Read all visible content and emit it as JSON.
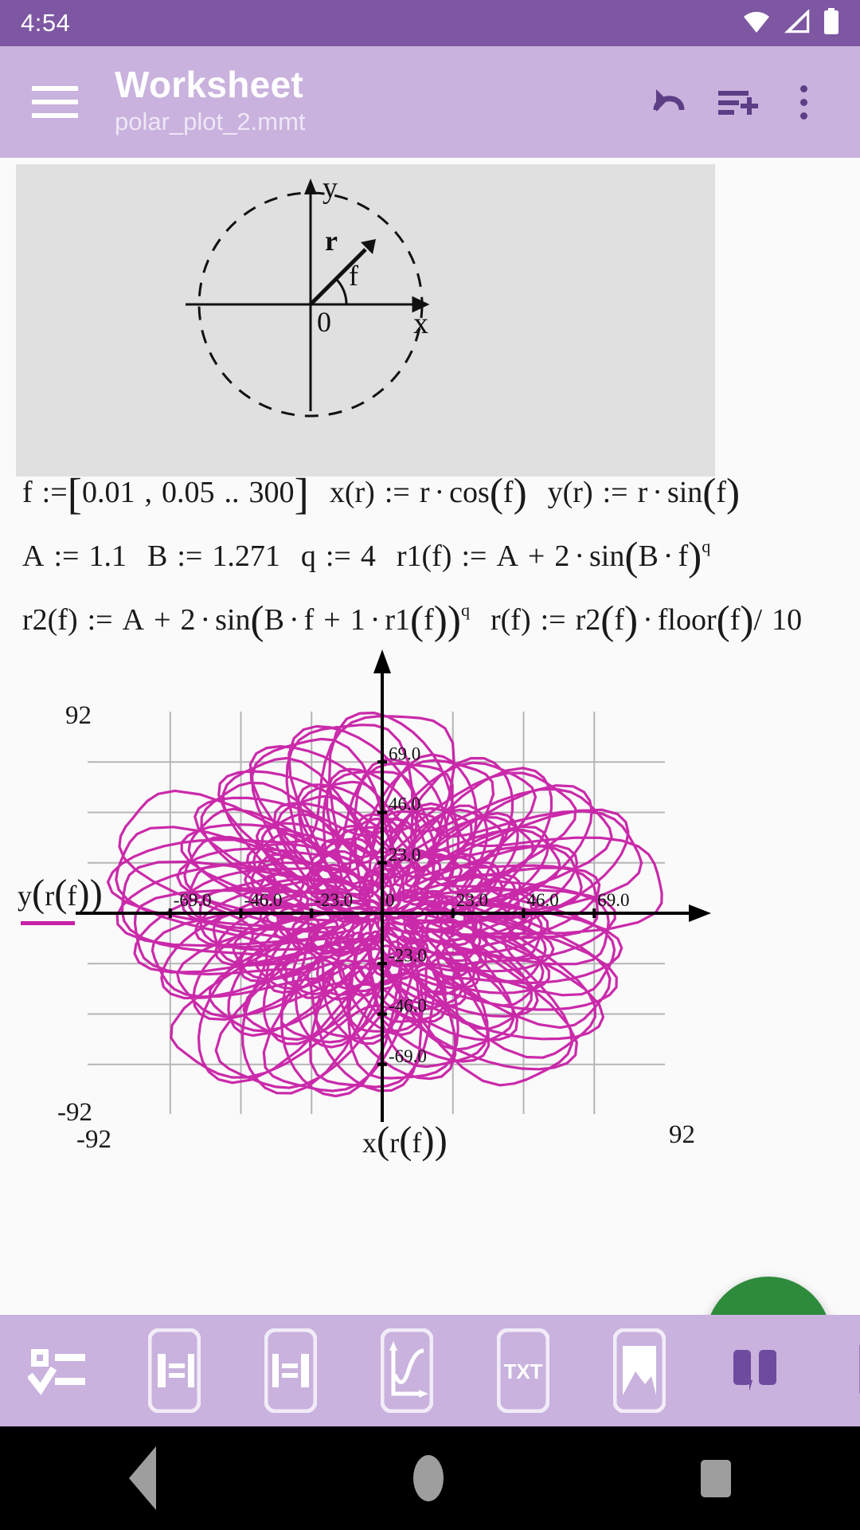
{
  "status_bar": {
    "time": "4:54",
    "icons": [
      "wifi-icon",
      "signal-icon",
      "battery-icon"
    ]
  },
  "app_bar": {
    "menu_icon": "hamburger-menu-icon",
    "title": "Worksheet",
    "subtitle": "polar_plot_2.mmt",
    "actions": [
      {
        "name": "undo-icon",
        "label": "Undo"
      },
      {
        "name": "add-line-icon",
        "label": "Insert line"
      },
      {
        "name": "overflow-menu-icon",
        "label": "More options"
      }
    ]
  },
  "document": {
    "header_image": {
      "name": "polar-coordinates-diagram",
      "labels": {
        "y_axis": "y",
        "x_axis": "x",
        "radius": "r",
        "angle": "f",
        "origin": "0"
      }
    },
    "formulas": [
      {
        "id": "line-1",
        "parts": [
          {
            "text": "f"
          },
          {
            "text": ":="
          },
          {
            "text": "["
          },
          {
            "text": "0.01"
          },
          {
            "text": ","
          },
          {
            "text": "0.05"
          },
          {
            "text": ".."
          },
          {
            "text": "300"
          },
          {
            "text": "]"
          },
          {
            "text": "x(r)"
          },
          {
            "text": ":="
          },
          {
            "text": "r"
          },
          {
            "text": "·"
          },
          {
            "text": "cos"
          },
          {
            "text": "("
          },
          {
            "text": "f"
          },
          {
            "text": ")"
          },
          {
            "text": "y(r)"
          },
          {
            "text": ":="
          },
          {
            "text": "r"
          },
          {
            "text": "·"
          },
          {
            "text": "sin"
          },
          {
            "text": "("
          },
          {
            "text": "f"
          },
          {
            "text": ")"
          }
        ],
        "plain": "f := [0.01 , 0.05 .. 300]   x(r) := r · cos(f)   y(r) := r · sin(f)"
      },
      {
        "id": "line-2",
        "plain": "A := 1.1   B := 1.271   q := 4   r1(f) := A + 2 · sin(B · f)^q"
      },
      {
        "id": "line-3",
        "plain": "r2(f) := A + 2 · sin(B · f + 1 · r1(f))^q   r(f) := r2(f) · floor(f)/10"
      }
    ],
    "assignments": {
      "A": "1.1",
      "B": "1.271",
      "q": "4",
      "f_range_start": "0.01",
      "f_range_step": "0.05",
      "f_range_end": "300",
      "divisor": "10"
    }
  },
  "chart_data": {
    "type": "line",
    "title": "",
    "xlabel": "x(r(f))",
    "ylabel": "y(r(f))",
    "xlim": [
      -92,
      92
    ],
    "ylim": [
      -92,
      92
    ],
    "x_corner_min": "-92",
    "x_corner_max": "92",
    "y_corner_min": "-92",
    "y_corner_max": "92",
    "xticks": [
      "-69.0",
      "-46.0",
      "-23.0",
      "0",
      "23.0",
      "46.0",
      "69.0"
    ],
    "xtick_values": [
      -69,
      -46,
      -23,
      0,
      23,
      46,
      69
    ],
    "yticks": [
      "69.0",
      "46.0",
      "23.0",
      "0",
      "-23.0",
      "-46.0",
      "-69.0"
    ],
    "ytick_values": [
      69,
      46,
      23,
      0,
      -23,
      -46,
      -69
    ],
    "grid": true,
    "legend_position": "left",
    "series": [
      {
        "name": "y(r(f))",
        "color": "#c71fa5",
        "parametric": true,
        "param": "f",
        "param_start": 0.01,
        "param_step": 0.05,
        "param_end": 300,
        "r_expression": "r2(f)*floor(f)/10",
        "x_expression": "r(f)*cos(f)",
        "y_expression": "r(f)*sin(f)"
      }
    ]
  },
  "run_button": {
    "name": "run-calculation-button",
    "icon": "play-icon"
  },
  "toolbar": {
    "items": [
      {
        "name": "toolbar-checklist",
        "icon": "checklist-icon",
        "label": ""
      },
      {
        "name": "toolbar-assign-right",
        "icon": "assign-right-icon",
        "label": ""
      },
      {
        "name": "toolbar-assign-left",
        "icon": "assign-left-icon",
        "label": ""
      },
      {
        "name": "toolbar-plot",
        "icon": "plot-icon",
        "label": ""
      },
      {
        "name": "toolbar-text",
        "icon": "txt-icon",
        "label": "TXT"
      },
      {
        "name": "toolbar-image",
        "icon": "image-icon",
        "label": ""
      },
      {
        "name": "toolbar-matrix",
        "icon": "matrix-icon",
        "label": ""
      },
      {
        "name": "toolbar-bracket",
        "icon": "bracket-icon",
        "label": ""
      }
    ]
  },
  "nav_bar": {
    "back": "back-nav-button",
    "home": "home-nav-button",
    "recents": "recents-nav-button"
  },
  "colors": {
    "status_bar": "#7e57a2",
    "app_bar": "#c9b2dd",
    "accent_purple": "#5b3e86",
    "curve": "#c71fa5",
    "fab_green": "#2e8b3c",
    "page_bg": "#fafafa",
    "image_bg": "#e0e0e0"
  }
}
